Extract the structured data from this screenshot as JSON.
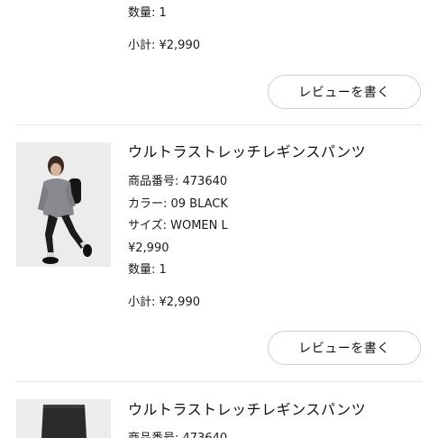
{
  "item_prev": {
    "quantity": "数量: 1",
    "subtotal": "小計: ¥2,990",
    "review_label": "レビューを書く"
  },
  "item1": {
    "name": "ウルトラストレッチレギンスパンツ",
    "product_number": "商品番号: 473640",
    "color": "カラー: 09 BLACK",
    "size": "サイズ: WOMEN L",
    "price": "¥2,990",
    "quantity": "数量: 1",
    "subtotal": "小計: ¥2,990",
    "review_label": "レビューを書く"
  },
  "item2": {
    "name": "ウルトラストレッチレギンスパンツ",
    "product_number_partial": "商品番号: 473640"
  },
  "colors": {
    "text": "#1b1b1b",
    "divider": "#e6e6e6",
    "button_border": "#cfcfcf",
    "thumb_bg": "#ebebeb"
  }
}
